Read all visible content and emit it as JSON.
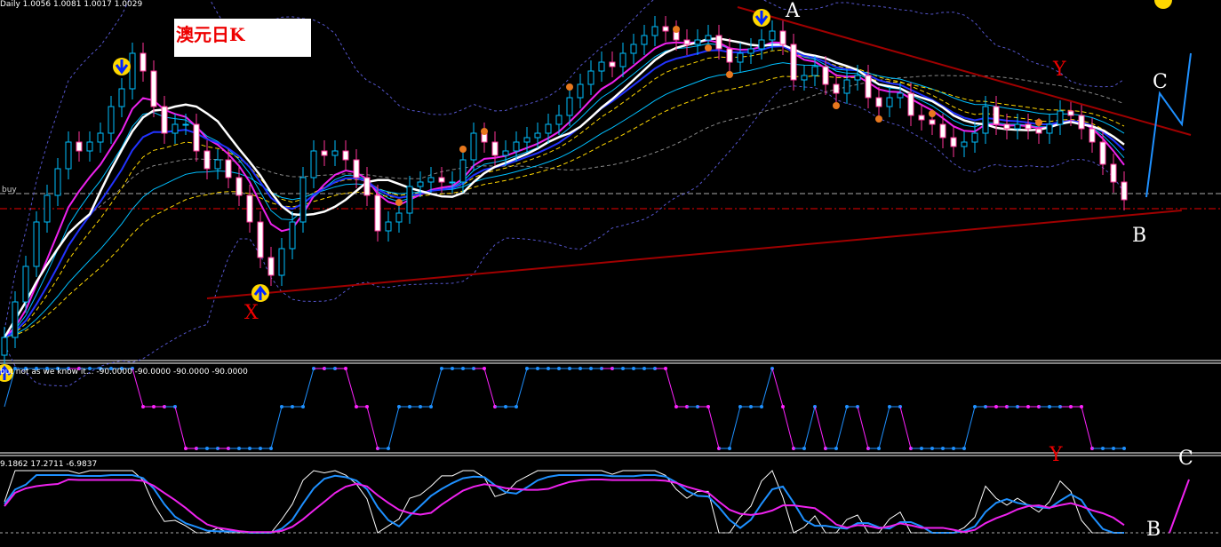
{
  "header": {
    "symbol_info": "Daily  1.0056 1.0081 1.0017 1.0029"
  },
  "title_box": "澳元日K",
  "buy_label": "buy",
  "indicator1": {
    "label": "but not as we know it...  -90.0000 -90.0000 -90.0000 -90.0000"
  },
  "indicator2": {
    "label": "9.1862 17.2711 -6.9837"
  },
  "annotations": {
    "A": "A",
    "B": "B",
    "C": "C",
    "X": "X",
    "Y": "Y",
    "Y2": "Y",
    "C2": "C",
    "B2": "B"
  },
  "colors": {
    "bull": "#00bfff",
    "bear": "#ff3399",
    "ma_blue": "#2233ff",
    "ma_magenta": "#ee22ee",
    "ma_white": "#ffffff",
    "trend": "#a00000",
    "projection": "#1e90ff"
  },
  "chart_data": {
    "type": "candlestick",
    "title": "澳元日K",
    "timeframe": "Daily",
    "closes": [
      1.002,
      1.006,
      1.01,
      1.015,
      1.018,
      1.021,
      1.024,
      1.023,
      1.024,
      1.025,
      1.028,
      1.03,
      1.034,
      1.032,
      1.028,
      1.025,
      1.026,
      1.026,
      1.023,
      1.021,
      1.022,
      1.02,
      1.018,
      1.015,
      1.011,
      1.009,
      1.012,
      1.015,
      1.02,
      1.023,
      1.0225,
      1.023,
      1.022,
      1.02,
      1.018,
      1.014,
      1.015,
      1.016,
      1.019,
      1.0195,
      1.02,
      1.0195,
      1.0195,
      1.022,
      1.025,
      1.024,
      1.0225,
      1.023,
      1.024,
      1.0245,
      1.025,
      1.026,
      1.027,
      1.029,
      1.0305,
      1.032,
      1.033,
      1.0325,
      1.034,
      1.035,
      1.036,
      1.037,
      1.0365,
      1.0355,
      1.035,
      1.0355,
      1.036,
      1.0345,
      1.033,
      1.034,
      1.0345,
      1.0355,
      1.0365,
      1.035,
      1.031,
      1.0315,
      1.0325,
      1.0305,
      1.0295,
      1.031,
      1.0315,
      1.029,
      1.028,
      1.029,
      1.0295,
      1.027,
      1.0265,
      1.026,
      1.0245,
      1.0235,
      1.024,
      1.025,
      1.028,
      1.026,
      1.0255,
      1.026,
      1.0255,
      1.025,
      1.026,
      1.0275,
      1.027,
      1.0255,
      1.024,
      1.0215,
      1.0195,
      1.0175
    ],
    "levels": {
      "buy": 1.0182,
      "red_dashed": 1.0165
    },
    "trendlines": [
      {
        "name": "upper",
        "from": [
          68.75,
          1.0392
        ],
        "to": [
          111.25,
          1.0248
        ]
      },
      {
        "name": "lower",
        "from": [
          19,
          1.0064
        ],
        "to": [
          110.4,
          1.0163
        ]
      }
    ]
  }
}
